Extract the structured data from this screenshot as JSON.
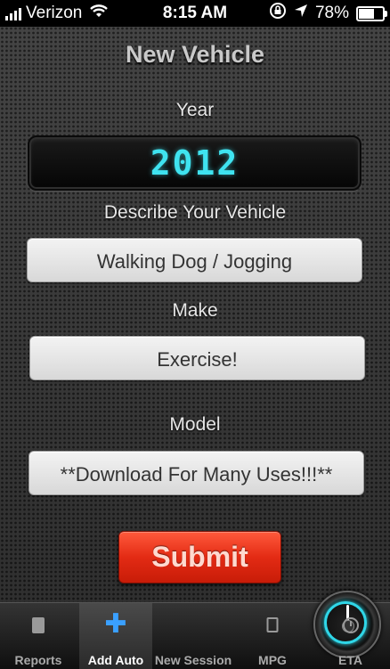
{
  "status_bar": {
    "carrier": "Verizon",
    "time": "8:15 AM",
    "battery": "78%",
    "battery_level": 0.78
  },
  "form": {
    "title": "New Vehicle",
    "year_label": "Year",
    "year_value": "2012",
    "describe_label": "Describe Your Vehicle",
    "describe_value": "Walking Dog / Jogging",
    "make_label": "Make",
    "make_value": "Exercise!",
    "model_label": "Model",
    "model_value": "**Download For Many Uses!!!**",
    "submit_label": "Submit"
  },
  "tabs": [
    {
      "label": "Reports",
      "icon": "document-icon",
      "active": false
    },
    {
      "label": "Add Auto",
      "icon": "plus-icon",
      "active": true
    },
    {
      "label": "New Session",
      "icon": "speedometer-icon",
      "active": false
    },
    {
      "label": "MPG",
      "icon": "calculator-icon",
      "active": false
    },
    {
      "label": "ETA",
      "icon": "clock-icon",
      "active": false
    }
  ],
  "colors": {
    "accent_digits": "#3fe3f0",
    "submit": "#e32b14",
    "tab_active_icon": "#3aa0ff"
  }
}
